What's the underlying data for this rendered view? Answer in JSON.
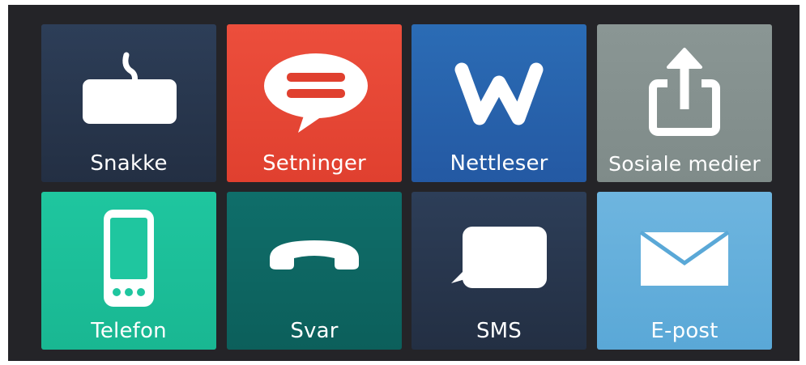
{
  "tiles": [
    {
      "label": "Snakke",
      "icon": "keyboard-icon",
      "color": "#2d3e58"
    },
    {
      "label": "Setninger",
      "icon": "speech-bubble-icon",
      "color": "#ec4e3c"
    },
    {
      "label": "Nettleser",
      "icon": "browser-w-icon",
      "color": "#2b6cb5"
    },
    {
      "label": "Sosiale medier",
      "icon": "share-icon",
      "color": "#8a9694"
    },
    {
      "label": "Telefon",
      "icon": "phone-icon",
      "color": "#1fc69f"
    },
    {
      "label": "Svar",
      "icon": "answer-call-icon",
      "color": "#0f6e6a"
    },
    {
      "label": "SMS",
      "icon": "message-icon",
      "color": "#2d3e58"
    },
    {
      "label": "E-post",
      "icon": "envelope-icon",
      "color": "#6eb5df"
    }
  ]
}
